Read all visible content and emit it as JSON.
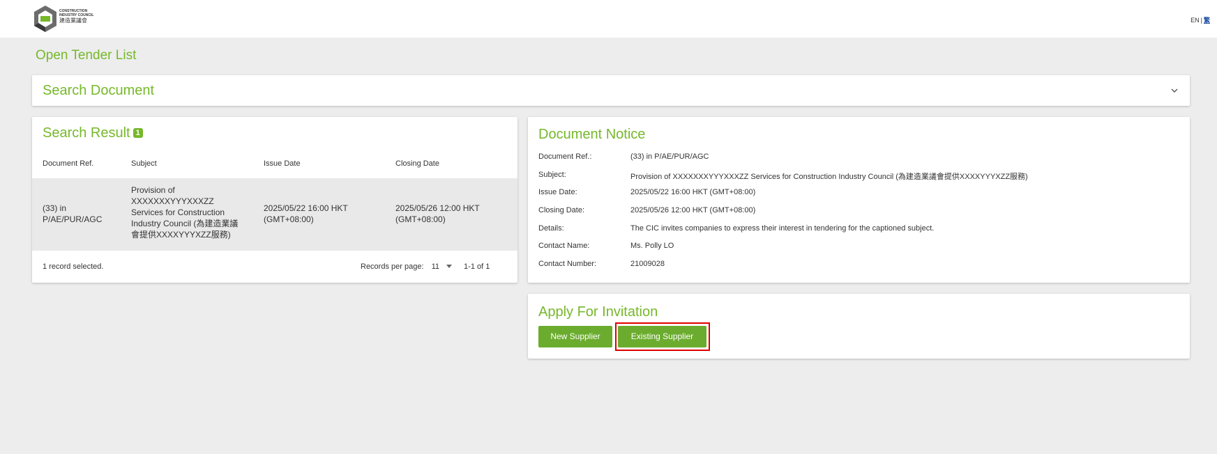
{
  "header": {
    "logo_text_en_1": "CONSTRUCTION",
    "logo_text_en_2": "INDUSTRY COUNCIL",
    "logo_text_zh": "建造業議會",
    "lang_en": "EN",
    "lang_sep": "|",
    "lang_alt": "繁"
  },
  "page_title": "Open Tender List",
  "search_document": {
    "title": "Search Document"
  },
  "search_result": {
    "title": "Search Result",
    "count": "1",
    "columns": [
      "Document Ref.",
      "Subject",
      "Issue Date",
      "Closing Date"
    ],
    "rows": [
      {
        "ref_1": "(33) in",
        "ref_2": "P/AE/PUR/AGC",
        "subject_1": "Provision of",
        "subject_2": "XXXXXXXYYYXXXZZ",
        "subject_3": "Services for Construction",
        "subject_4": "Industry Council (為建造業議",
        "subject_5": "會提供XXXXYYYXZZ服務)",
        "issue_1": "2025/05/22 16:00 HKT",
        "issue_2": "(GMT+08:00)",
        "closing_1": "2025/05/26 12:00 HKT",
        "closing_2": "(GMT+08:00)"
      }
    ],
    "footer": {
      "selected": "1 record selected.",
      "rpp_label": "Records per page:",
      "rpp_value": "11",
      "range": "1-1 of 1"
    }
  },
  "document_notice": {
    "title": "Document Notice",
    "fields": [
      {
        "label": "Document Ref.:",
        "value": "(33) in P/AE/PUR/AGC"
      },
      {
        "label": "Subject:",
        "value": "Provision of XXXXXXXYYYXXXZZ Services for Construction Industry Council (為建造業議會提供XXXXYYYXZZ服務)"
      },
      {
        "label": "Issue Date:",
        "value": "2025/05/22 16:00 HKT (GMT+08:00)"
      },
      {
        "label": "Closing Date:",
        "value": "2025/05/26 12:00 HKT (GMT+08:00)"
      },
      {
        "label": "Details:",
        "value": "The CIC invites companies to express their interest in tendering for the captioned subject."
      },
      {
        "label": "Contact Name:",
        "value": "Ms. Polly LO"
      },
      {
        "label": "Contact Number:",
        "value": "21009028"
      }
    ]
  },
  "apply": {
    "title": "Apply For Invitation",
    "new_supplier": "New Supplier",
    "existing_supplier": "Existing Supplier"
  },
  "colors": {
    "accent": "#76b82a",
    "button": "#6bac2e",
    "highlight": "#e00000"
  }
}
